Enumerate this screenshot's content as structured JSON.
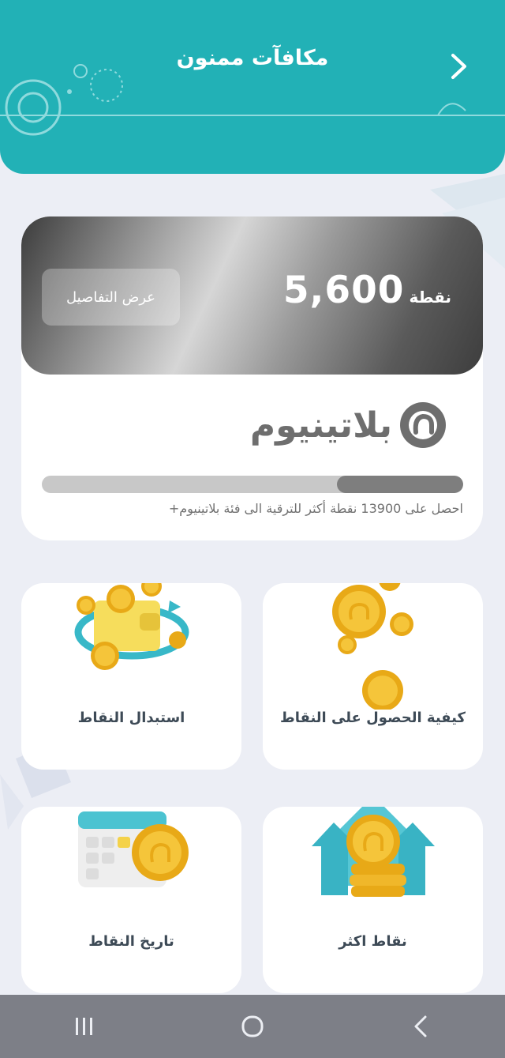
{
  "header": {
    "title": "مكافآت ممنون",
    "back_icon": "chevron-right-icon",
    "color": "#22b1b6"
  },
  "points_card": {
    "points": "5,600",
    "points_unit": "نقطة",
    "details_button": "عرض التفاصيل",
    "tier_name": "بلاتينيوم",
    "progress_fraction": 0.3,
    "progress_text": "احصل على 13900 نقطة أكثر للترقية الى فئة بلاتينيوم+"
  },
  "tiles": [
    {
      "label": "كيفية الحصول على النقاط",
      "icon": "coins-icon"
    },
    {
      "label": "استبدال النقاط",
      "icon": "wallet-exchange-icon"
    },
    {
      "label": "نقاط اكثر",
      "icon": "coin-upgrade-icon"
    },
    {
      "label": "تاريخ النقاط",
      "icon": "calendar-coin-icon"
    }
  ],
  "navbar": {
    "recent_icon": "recent-apps-icon",
    "home_icon": "home-icon",
    "back_icon": "back-icon",
    "color": "#7d7f87"
  }
}
